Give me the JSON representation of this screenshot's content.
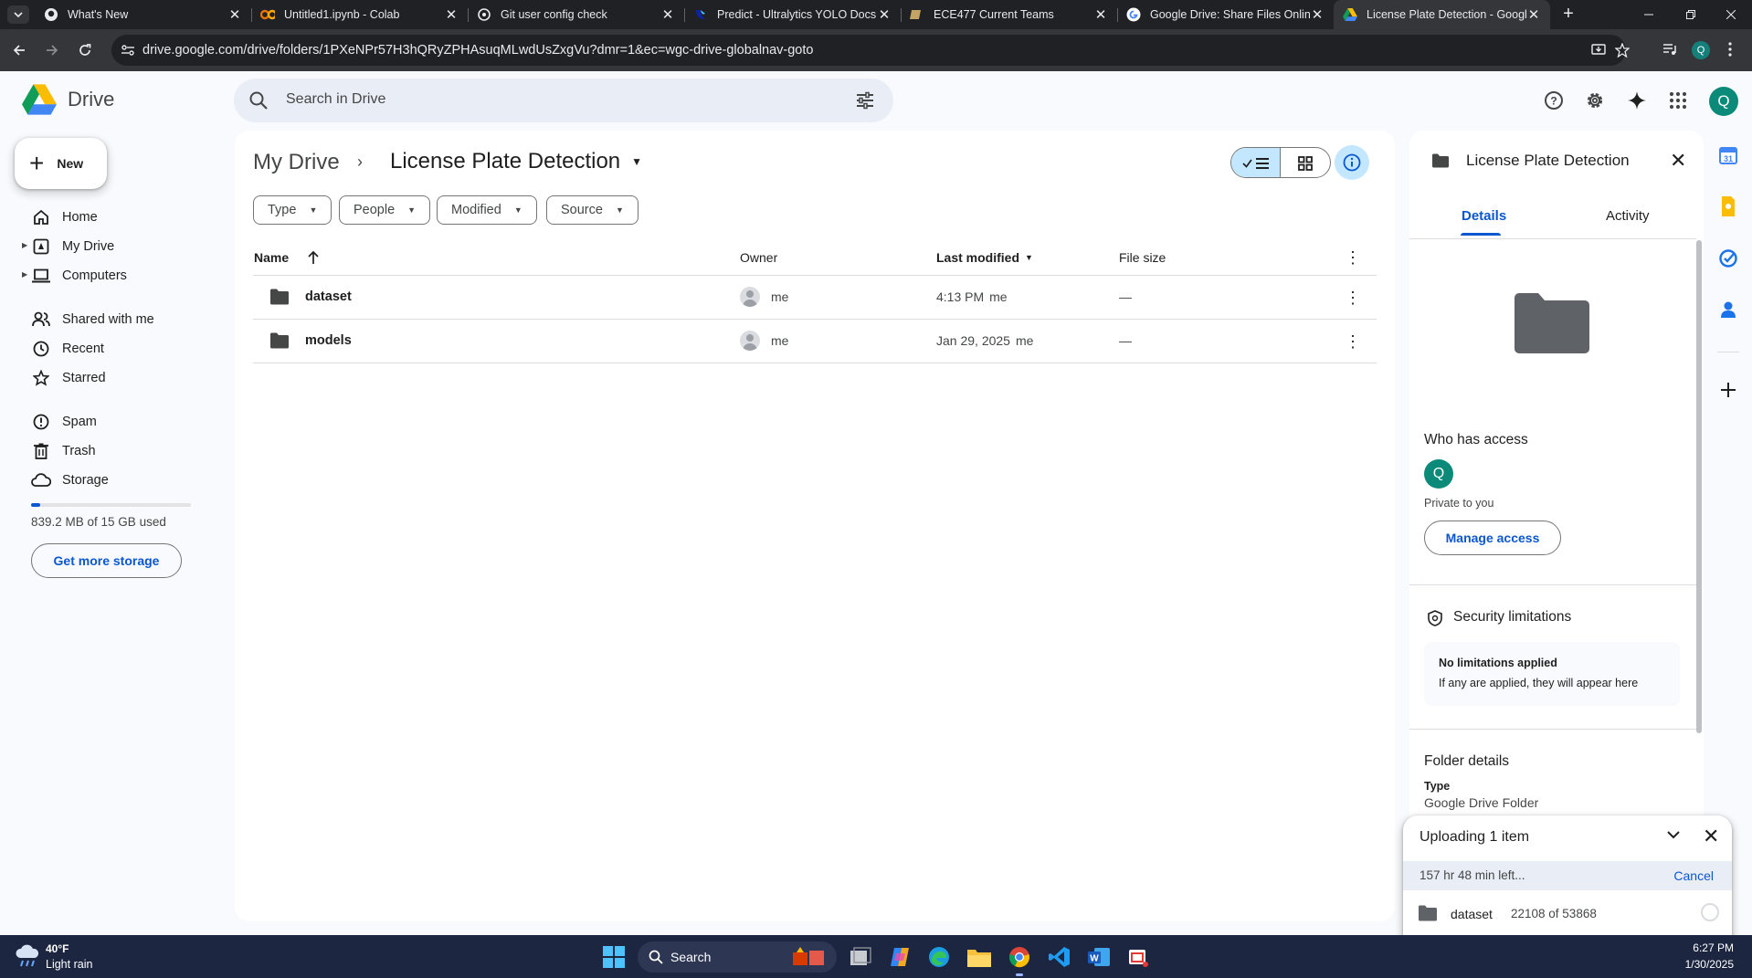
{
  "browser": {
    "tabs": [
      {
        "title": "What's New",
        "icon": "github-icon"
      },
      {
        "title": "Untitled1.ipynb - Colab",
        "icon": "colab-icon"
      },
      {
        "title": "Git user config check",
        "icon": "chatgpt-icon"
      },
      {
        "title": "Predict - Ultralytics YOLO Docs",
        "icon": "ultralytics-icon"
      },
      {
        "title": "ECE477 Current Teams",
        "icon": "purdue-icon"
      },
      {
        "title": "Google Drive: Share Files Online",
        "icon": "google-icon"
      },
      {
        "title": "License Plate Detection - Google Drive",
        "icon": "drive-icon"
      }
    ],
    "active_tab_index": 6,
    "url": "drive.google.com/drive/folders/1PXeNPr57H3hQRyZPHAsuqMLwdUsZxgVu?dmr=1&ec=wgc-drive-globalnav-goto",
    "profile_initial": "Q"
  },
  "drive": {
    "logo_text": "Drive",
    "search_placeholder": "Search in Drive",
    "user_initial": "Q",
    "new_label": "New",
    "nav": [
      {
        "label": "Home",
        "icon": "home-icon"
      },
      {
        "label": "My Drive",
        "icon": "my-drive-icon"
      },
      {
        "label": "Computers",
        "icon": "computer-icon"
      },
      {
        "label": "Shared with me",
        "icon": "shared-icon"
      },
      {
        "label": "Recent",
        "icon": "clock-icon"
      },
      {
        "label": "Starred",
        "icon": "star-icon"
      },
      {
        "label": "Spam",
        "icon": "spam-icon"
      },
      {
        "label": "Trash",
        "icon": "trash-icon"
      },
      {
        "label": "Storage",
        "icon": "cloud-icon"
      }
    ],
    "storage_used_fraction": 0.055,
    "storage_text": "839.2 MB of 15 GB used",
    "get_storage_label": "Get more storage"
  },
  "main": {
    "breadcrumb_root": "My Drive",
    "breadcrumb_current": "License Plate Detection",
    "filters": [
      "Type",
      "People",
      "Modified",
      "Source"
    ],
    "columns": {
      "name": "Name",
      "owner": "Owner",
      "last_modified": "Last modified",
      "file_size": "File size"
    },
    "rows": [
      {
        "name": "dataset",
        "owner": "me",
        "modified": "4:13 PM",
        "modified_by": "me",
        "size": "—"
      },
      {
        "name": "models",
        "owner": "me",
        "modified": "Jan 29, 2025",
        "modified_by": "me",
        "size": "—"
      }
    ]
  },
  "details": {
    "title": "License Plate Detection",
    "tabs": [
      "Details",
      "Activity"
    ],
    "active_tab": "Details",
    "who_has_access": "Who has access",
    "owner_initial": "Q",
    "private_text": "Private to you",
    "manage_access": "Manage access",
    "security_title": "Security limitations",
    "security_line1": "No limitations applied",
    "security_line2": "If any are applied, they will appear here",
    "folder_details": "Folder details",
    "type_label": "Type",
    "type_value": "Google Drive Folder"
  },
  "upload": {
    "title": "Uploading 1 item",
    "time_left": "157 hr 48 min left...",
    "cancel": "Cancel",
    "item_name": "dataset",
    "item_progress": "22108 of 53868"
  },
  "taskbar": {
    "temp": "40°F",
    "weather": "Light rain",
    "search": "Search",
    "time": "6:27 PM",
    "date": "1/30/2025"
  },
  "colors": {
    "accent": "#0b57d0",
    "selected": "#c2e7ff",
    "avatar": "#0b8a7a",
    "taskbar": "#1c2641"
  }
}
